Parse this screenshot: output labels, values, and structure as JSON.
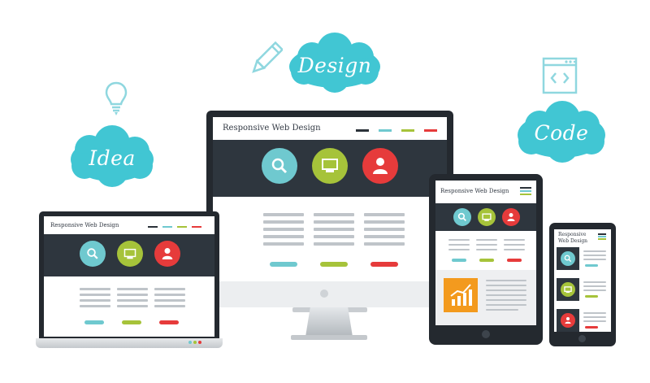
{
  "clouds": {
    "idea": "Idea",
    "design": "Design",
    "code": "Code"
  },
  "icons": {
    "lightbulb": "lightbulb-icon",
    "pencil": "pencil-icon",
    "code_window": "code-window-icon",
    "search": "search-icon",
    "monitor": "monitor-icon",
    "user": "user-icon",
    "chart": "chart-icon"
  },
  "monitor": {
    "title": "Responsive Web Design"
  },
  "laptop": {
    "title": "Responsive Web Design"
  },
  "tablet": {
    "title": "Responsive Web Design"
  },
  "phone": {
    "title": "Responsive Web Design"
  },
  "colors": {
    "cloud": "#41c6d3",
    "teal": "#6fc9cf",
    "green": "#a6c33a",
    "red": "#e63b3b",
    "orange": "#f39a1e",
    "dark": "#2b3239",
    "frame": "#24292f"
  }
}
